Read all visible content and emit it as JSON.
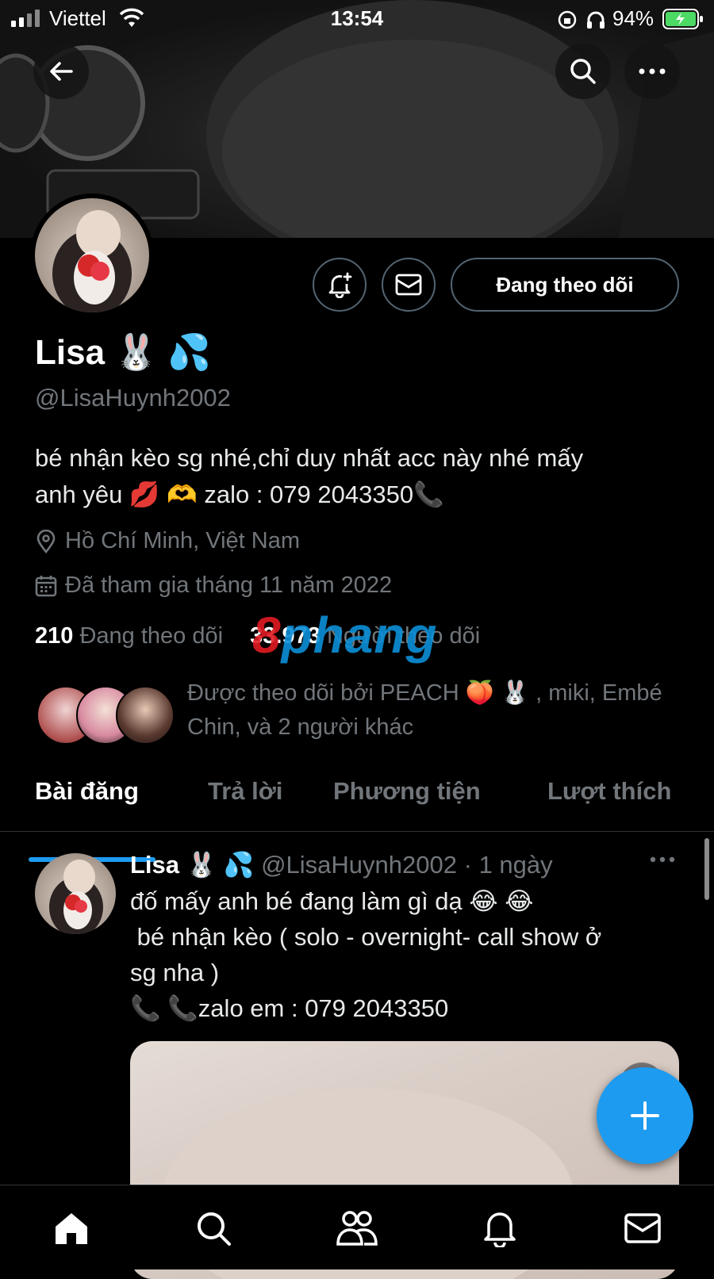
{
  "status_bar": {
    "carrier": "Viettel",
    "time": "13:54",
    "battery_percent": "94%"
  },
  "profile": {
    "name": "Lisa 🐰 💦",
    "handle": "@LisaHuynh2002",
    "follow_button_label": "Đang theo dõi",
    "bio_line1": "bé nhận kèo sg nhé,chỉ duy nhất acc này nhé mấy",
    "bio_line2": "anh yêu 💋 🫶 zalo : 079 2043350📞",
    "location": "Hồ Chí Minh, Việt Nam",
    "joined": "Đã tham gia tháng 11 năm 2022",
    "following_count": "210",
    "following_label": "Đang theo dõi",
    "followers_count": "33.973",
    "followers_label": "Người theo dõi",
    "followed_by_line1": "Được theo dõi bởi PEACH 🍑 🐰 , miki, Embé",
    "followed_by_line2": "Chin, và 2 người khác"
  },
  "watermark": {
    "first_letter": "8",
    "rest": "phang"
  },
  "tabs": [
    {
      "label": "Bài đăng",
      "active": true
    },
    {
      "label": "Trả lời",
      "active": false
    },
    {
      "label": "Phương tiện",
      "active": false
    },
    {
      "label": "Lượt thích",
      "active": false
    }
  ],
  "post": {
    "author_name": "Lisa 🐰 💦",
    "author_handle": "@LisaHuynh2002",
    "time_separator": "·",
    "time": "1 ngày",
    "lines": [
      "đố mấy anh bé đang làm gì dạ 😂 😂",
      " bé nhận kèo ( solo - overnight- call show ở",
      "sg nha )",
      "📞 📞zalo em : 079 2043350"
    ]
  },
  "icons": {
    "back": "back-arrow-icon",
    "search": "search-icon",
    "more": "more-icon",
    "notify": "bell-plus-icon",
    "message": "envelope-icon",
    "location": "location-pin-icon",
    "calendar": "calendar-icon",
    "compose": "plus-icon",
    "nav": [
      "home-icon",
      "search-icon",
      "communities-icon",
      "notifications-icon",
      "messages-icon"
    ]
  },
  "colors": {
    "accent": "#1d9bf0",
    "background": "#000000",
    "secondary_text": "#71767b"
  }
}
